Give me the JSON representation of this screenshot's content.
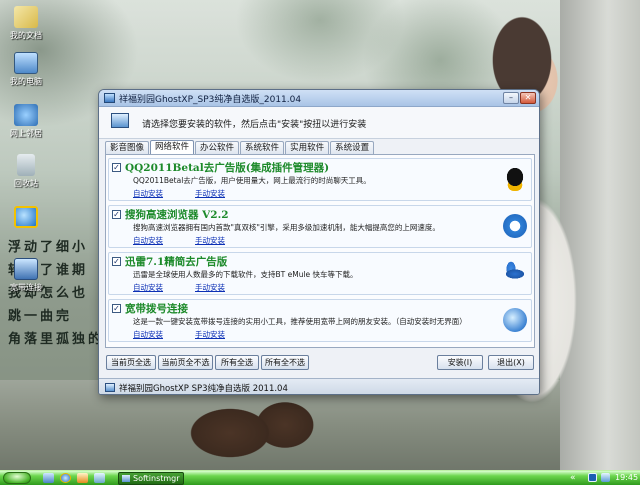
{
  "desktop": {
    "icons": [
      {
        "label": "我的文档",
        "icon": "documents-folder-icon"
      },
      {
        "label": "我的电脑",
        "icon": "computer-icon"
      },
      {
        "label": "网上邻居",
        "icon": "network-places-icon"
      },
      {
        "label": "回收站",
        "icon": "recycle-bin-icon"
      },
      {
        "label": "",
        "icon": "internet-explorer-icon"
      },
      {
        "label": "宽带连接",
        "icon": "broadband-connection-icon"
      }
    ],
    "poem": [
      "浮动了细小",
      "转载了谁期",
      "我却怎么也",
      "跳一曲完",
      "角落里孤独的"
    ]
  },
  "window": {
    "title": "祥福别园GhostXP_SP3纯净自选版_2011.04",
    "minimize_symbol": "–",
    "close_symbol": "✕",
    "instruction": "请选择您要安装的软件，然后点击\"安装\"按扭以进行安装",
    "tabs": [
      "影音图像",
      "网络软件",
      "办公软件",
      "系统软件",
      "实用软件",
      "系统设置"
    ],
    "active_tab": "网络软件",
    "items": [
      {
        "checked": true,
        "title": "QQ2011Betal去广告版(集成插件管理器)",
        "desc": "QQ2011Betal去广告版，用户使用量大，网上最流行的时尚聊天工具。",
        "auto_link": "自动安装",
        "manual_link": "手动安装",
        "logo": "qq-penguin-icon"
      },
      {
        "checked": true,
        "title": "搜狗高速浏览器 V2.2",
        "desc": "搜狗高速浏览器拥有国内首款\"真双核\"引擎，采用多级加速机制，能大幅提高您的上网速度。",
        "auto_link": "自动安装",
        "manual_link": "手动安装",
        "logo": "sogou-browser-icon"
      },
      {
        "checked": true,
        "title": "迅雷7.1精简去广告版",
        "desc": "迅雷是全球使用人数最多的下载软件，支持BT eMule 快车等下载。",
        "auto_link": "自动安装",
        "manual_link": "手动安装",
        "logo": "thunder-bird-icon"
      },
      {
        "checked": true,
        "title": "宽带拨号连接",
        "desc": "这是一款一键安装宽带拨号连接的实用小工具，推荐使用宽带上网的朋友安装。（自动安装时无界面）",
        "auto_link": "自动安装",
        "manual_link": "手动安装",
        "logo": "broadband-dial-icon"
      }
    ],
    "buttons": {
      "select_page": "当前页全选",
      "deselect_page": "当前页全不选",
      "select_all": "所有全选",
      "deselect_all": "所有全不选",
      "install": "安装(I)",
      "exit": "退出(X)"
    },
    "status": "祥福别园GhostXP SP3纯净自选版 2011.04"
  },
  "taskbar": {
    "task_label": "Softinstmgr",
    "tray_chevron": "«",
    "clock": "19:45"
  },
  "colors": {
    "item_title": "#1c8a2a",
    "link": "#0b2fb5",
    "taskbar_green": "#2f9a1d"
  }
}
